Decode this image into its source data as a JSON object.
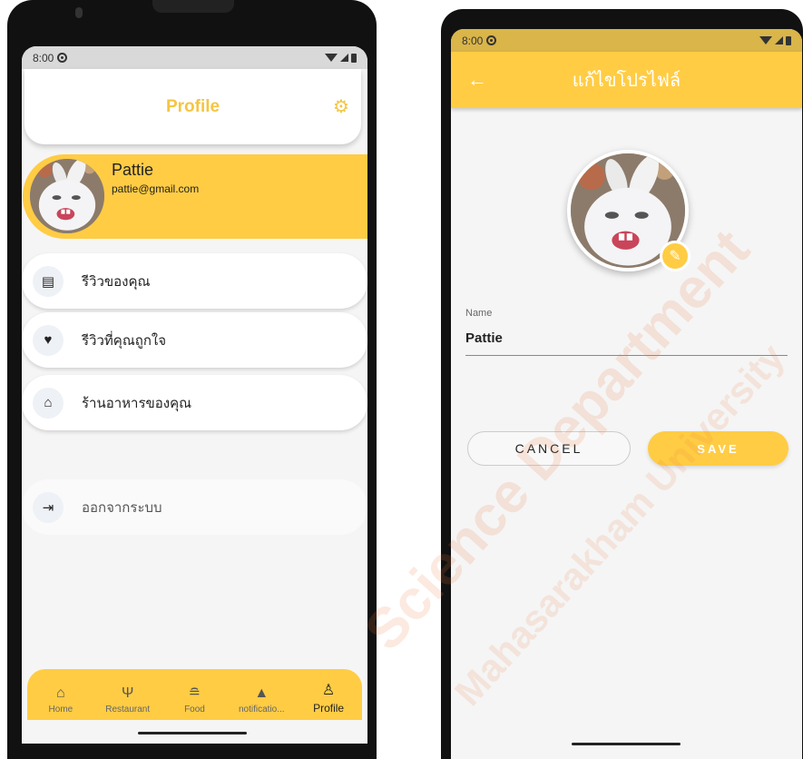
{
  "left_screen": {
    "status": {
      "time": "8:00"
    },
    "header": {
      "title": "Profile",
      "settings_icon": "settings-gear-icon"
    },
    "user": {
      "name": "Pattie",
      "email": "pattie@gmail.com"
    },
    "menu": [
      {
        "icon": "article-icon",
        "label": "รีวิวของคุณ"
      },
      {
        "icon": "heart-icon",
        "label": "รีวิวที่คุณถูกใจ"
      },
      {
        "icon": "store-icon",
        "label": "ร้านอาหารของคุณ"
      }
    ],
    "logout": {
      "icon": "logout-icon",
      "label": "ออกจากระบบ"
    },
    "bottom_nav": [
      {
        "icon": "home-icon",
        "label": "Home"
      },
      {
        "icon": "restaurant-icon",
        "label": "Restaurant"
      },
      {
        "icon": "food-icon",
        "label": "Food"
      },
      {
        "icon": "bell-icon",
        "label": "notificatio..."
      },
      {
        "icon": "person-icon",
        "label": "Profile",
        "active": true
      }
    ]
  },
  "right_screen": {
    "status": {
      "time": "8:00"
    },
    "appbar": {
      "title": "แก้ไขโปรไฟล์",
      "back_icon": "back-arrow-icon"
    },
    "form": {
      "name_label": "Name",
      "name_value": "Pattie"
    },
    "buttons": {
      "cancel": "CANCEL",
      "save": "SAVE"
    }
  },
  "colors": {
    "accent": "#ffcc44",
    "title_yellow": "#f5c542",
    "background": "#f5f5f5"
  },
  "watermark": {
    "line1": "Science Department",
    "line2": "Mahasarakham University"
  }
}
